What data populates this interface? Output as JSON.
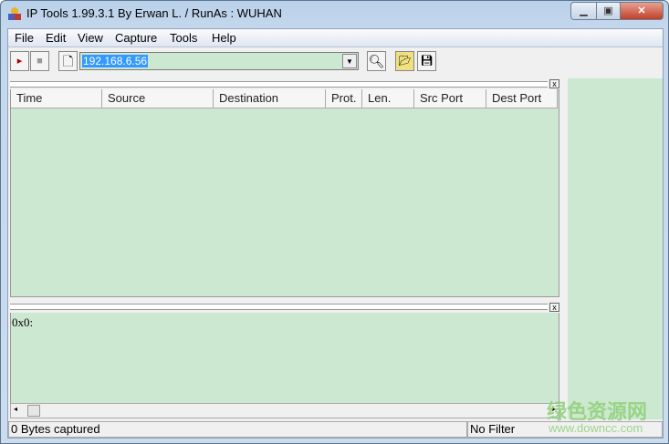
{
  "window": {
    "title": "IP Tools 1.99.3.1 By Erwan L. / RunAs : WUHAN"
  },
  "menu": [
    "File",
    "Edit",
    "View",
    "Capture",
    "Tools",
    "Help"
  ],
  "toolbar": {
    "address": "192.168.6.56"
  },
  "columns": [
    "Time",
    "Source",
    "Destination",
    "Prot.",
    "Len.",
    "Src Port",
    "Dest Port"
  ],
  "hex": {
    "text": "0x0:"
  },
  "status": {
    "captured": "0 Bytes captured",
    "filter": "No Filter"
  },
  "watermark": {
    "cn": "绿色资源网",
    "url": "www.downcc.com"
  },
  "colors": {
    "pane": "#cde8d0",
    "selection": "#3399ff"
  }
}
